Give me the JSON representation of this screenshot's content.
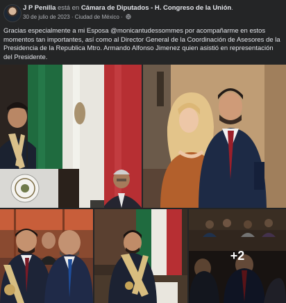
{
  "post": {
    "author": "J P Penilla",
    "action_text": "está en",
    "location": "Cámara de Diputados - H. Congreso de la Unión",
    "punctuation": ".",
    "date": "30 de julio de 2023",
    "separator": "·",
    "city": "Ciudad de México",
    "separator2": "·",
    "privacy_icon": "globe-icon",
    "text": "Gracias especialmente a mi Esposa @monicantudessommes por acompañarme en estos momentos tan importantes, así como al Director General de la Coordinación de Asesores de la Presidencia de la Republica Mtro. Armando Alfonso Jimenez quien asistió en representación del Presidente."
  },
  "photos": {
    "more_count": "+2"
  }
}
